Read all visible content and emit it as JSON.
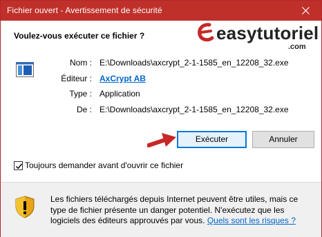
{
  "window": {
    "title": "Fichier ouvert - Avertissement de sécurité"
  },
  "dialog": {
    "question": "Voulez-vous exécuter ce fichier ?",
    "logo": {
      "text": "easytutoriel",
      "sub": ".com"
    },
    "fields": [
      {
        "label": "Nom :",
        "value": "E:\\Downloads\\axcrypt_2-1-1585_en_12208_32.exe"
      },
      {
        "label": "Éditeur :",
        "value": "AxCrypt AB"
      },
      {
        "label": "Type :",
        "value": "Application"
      },
      {
        "label": "De :",
        "value": "E:\\Downloads\\axcrypt_2-1-1585_en_12208_32.exe"
      }
    ],
    "buttons": {
      "run": "Exécuter",
      "cancel": "Annuler"
    },
    "checkbox": {
      "label": "Toujours demander avant d'ouvrir ce fichier",
      "checked": true
    }
  },
  "footer": {
    "warning": "Les fichiers téléchargés depuis Internet peuvent être utiles, mais ce type de fichier présente un danger potentiel. N'exécutez que les logiciels des éditeurs approuvés par vous.",
    "link": "Quels sont les risques ?"
  },
  "colors": {
    "titlebar": "#c0302a",
    "link": "#0066cc",
    "arrow": "#c62828",
    "focus": "#0078d7"
  },
  "icons": [
    "close-icon",
    "easytutoriel-logo-icon",
    "application-file-icon",
    "red-arrow-icon",
    "checkmark-icon",
    "warning-shield-icon"
  ]
}
